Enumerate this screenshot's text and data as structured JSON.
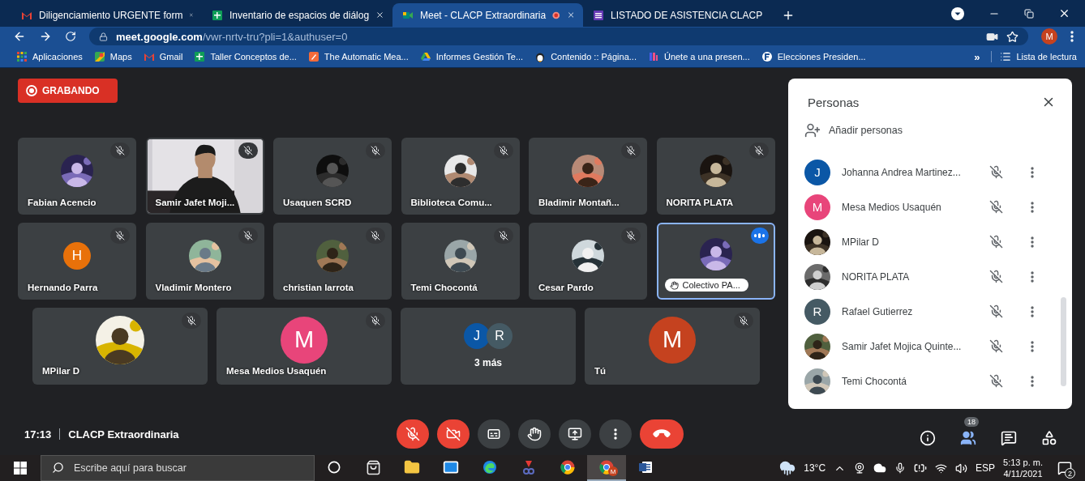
{
  "browser": {
    "tabs": [
      {
        "title": "Diligenciamiento URGENTE form",
        "kind": "gmail",
        "selected": false
      },
      {
        "title": "Inventario de espacios de diálog",
        "kind": "sheets",
        "selected": false
      },
      {
        "title": "Meet - CLACP Extraordinaria",
        "kind": "meet",
        "selected": true,
        "recording": true
      },
      {
        "title": "LISTADO DE ASISTENCIA CLACP",
        "kind": "forms",
        "selected": false
      }
    ],
    "url": {
      "host": "meet.google.com",
      "path": "/vwr-nrtv-tru?pli=1&authuser=0"
    },
    "profile_initial": "M",
    "bookmarks": [
      {
        "label": "Aplicaciones",
        "kind": "apps"
      },
      {
        "label": "Maps",
        "kind": "maps"
      },
      {
        "label": "Gmail",
        "kind": "gmail"
      },
      {
        "label": "Taller Conceptos de...",
        "kind": "sheets"
      },
      {
        "label": "The Automatic Mea...",
        "kind": "orange"
      },
      {
        "label": "Informes Gestión Te...",
        "kind": "drive"
      },
      {
        "label": "Contenido :: Página...",
        "kind": "penguin"
      },
      {
        "label": "Únete a una presen...",
        "kind": "pink"
      },
      {
        "label": "Elecciones Presiden...",
        "kind": "round"
      }
    ],
    "overflow": "»",
    "reading_list": "Lista de lectura"
  },
  "meet": {
    "recording": "GRABANDO",
    "tile_rows": [
      [
        {
          "name": "Fabian Acencio",
          "kind": "picture",
          "muted": true,
          "speaking": false,
          "hand_raised": false
        },
        {
          "name": "Samir Jafet Moji...",
          "kind": "video",
          "muted": true,
          "speaking": false,
          "hand_raised": false
        },
        {
          "name": "Usaquen SCRD",
          "kind": "picture",
          "muted": true,
          "speaking": false,
          "hand_raised": false
        },
        {
          "name": "Biblioteca Comu...",
          "kind": "picture",
          "muted": true,
          "speaking": false,
          "hand_raised": false
        },
        {
          "name": "Bladimir Montañ...",
          "kind": "picture",
          "muted": true,
          "speaking": false,
          "hand_raised": false
        },
        {
          "name": "NORITA PLATA",
          "kind": "picture",
          "muted": true,
          "speaking": false,
          "hand_raised": false
        }
      ],
      [
        {
          "name": "Hernando Parra",
          "kind": "letter",
          "letter": "H",
          "color": "#e8710a",
          "muted": true,
          "speaking": false,
          "hand_raised": false
        },
        {
          "name": "Vladimir Montero",
          "kind": "picture",
          "muted": true,
          "speaking": false,
          "hand_raised": false
        },
        {
          "name": "christian larrota",
          "kind": "picture",
          "muted": true,
          "speaking": false,
          "hand_raised": false
        },
        {
          "name": "Temi Chocontá",
          "kind": "picture",
          "muted": true,
          "speaking": false,
          "hand_raised": false
        },
        {
          "name": "Cesar Pardo",
          "kind": "picture",
          "muted": true,
          "speaking": false,
          "hand_raised": false
        },
        {
          "name": "Colectivo PA...",
          "kind": "picture",
          "muted": false,
          "speaking": true,
          "hand_raised": true
        }
      ],
      [
        {
          "name": "MPilar D",
          "kind": "picture",
          "muted": true,
          "speaking": false,
          "hand_raised": false
        },
        {
          "name": "Mesa Medios Usaquén",
          "kind": "letter",
          "letter": "M",
          "color": "#e8457a",
          "muted": true,
          "speaking": false,
          "hand_raised": false
        },
        {
          "name": "3 más",
          "kind": "more",
          "avatars": [
            {
              "letter": "J",
              "color": "#0b57a6"
            },
            {
              "letter": "R",
              "color": "#455a64"
            }
          ],
          "muted": false,
          "speaking": false,
          "hand_raised": false
        },
        {
          "name": "Tú",
          "kind": "letter",
          "letter": "M",
          "color": "#c5421f",
          "muted": true,
          "speaking": false,
          "hand_raised": false
        }
      ]
    ],
    "meeting_time": "17:13",
    "meeting_title": "CLACP Extraordinaria",
    "controls": [
      {
        "kind": "mic",
        "off": true
      },
      {
        "kind": "camera",
        "off": true
      },
      {
        "kind": "captions"
      },
      {
        "kind": "hand"
      },
      {
        "kind": "present"
      },
      {
        "kind": "more"
      },
      {
        "kind": "end"
      }
    ],
    "side_buttons": [
      {
        "kind": "info",
        "selected": false
      },
      {
        "kind": "people",
        "badge": "18",
        "selected": true
      },
      {
        "kind": "chat",
        "selected": false
      },
      {
        "kind": "activities",
        "selected": false
      }
    ]
  },
  "people_panel": {
    "title": "Personas",
    "add_label": "Añadir personas",
    "people": [
      {
        "name": "Johanna Andrea Martinez...",
        "kind": "letter",
        "letter": "J",
        "color": "#0b57a6",
        "muted": true
      },
      {
        "name": "Mesa Medios Usaquén",
        "kind": "letter",
        "letter": "M",
        "color": "#e8457a",
        "muted": true
      },
      {
        "name": "MPilar D",
        "kind": "picture",
        "muted": true
      },
      {
        "name": "NORITA PLATA",
        "kind": "picture",
        "muted": true
      },
      {
        "name": "Rafael Gutierrez",
        "kind": "letter",
        "letter": "R",
        "color": "#455a64",
        "muted": true
      },
      {
        "name": "Samir Jafet Mojica Quinte...",
        "kind": "picture",
        "muted": true
      },
      {
        "name": "Temi Chocontá",
        "kind": "picture",
        "muted": true
      }
    ]
  },
  "taskbar": {
    "search_placeholder": "Escribe aquí para buscar",
    "apps": [
      {
        "kind": "cortana",
        "selected": false
      },
      {
        "kind": "store",
        "selected": false
      },
      {
        "kind": "folder",
        "selected": false
      },
      {
        "kind": "mail",
        "selected": false
      },
      {
        "kind": "edge",
        "selected": false
      },
      {
        "kind": "snip",
        "selected": false
      },
      {
        "kind": "chrome",
        "selected": false
      },
      {
        "kind": "chrome",
        "badge": "M",
        "selected": true
      },
      {
        "kind": "word",
        "selected": false
      }
    ],
    "temperature": "13°C",
    "language": "ESP",
    "time": "5:13 p. m.",
    "date": "4/11/2021",
    "notifications": "2"
  }
}
